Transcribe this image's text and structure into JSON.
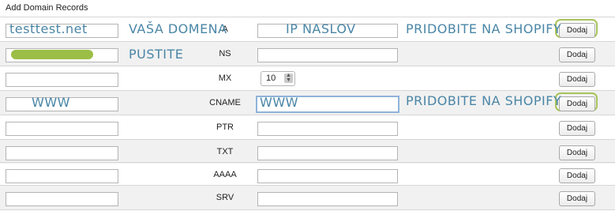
{
  "section_title": "Add Domain Records",
  "add_label": "Dodaj",
  "rows": [
    {
      "type": "A",
      "name": "testtest.net",
      "value": "IP NASLOV"
    },
    {
      "type": "NS",
      "name": "",
      "value": ""
    },
    {
      "type": "MX",
      "name": "",
      "priority": "10"
    },
    {
      "type": "CNAME",
      "name": "WWW",
      "value": "WWW"
    },
    {
      "type": "PTR",
      "name": "",
      "value": ""
    },
    {
      "type": "TXT",
      "name": "",
      "value": ""
    },
    {
      "type": "AAAA",
      "name": "",
      "value": ""
    },
    {
      "type": "SRV",
      "name": "",
      "value": ""
    }
  ],
  "annotations": {
    "your_domain": "VAŠA DOMENA",
    "get_on_shopify_1": "PRIDOBITE NA SHOPIFY",
    "leave": "PUSTITE",
    "get_on_shopify_2": "PRIDOBITE NA SHOPIFY"
  },
  "colors": {
    "annotation": "#4a86a6",
    "highlight": "#a7c35a",
    "redaction": "#9bbe46",
    "focus": "#8fb3d9"
  }
}
